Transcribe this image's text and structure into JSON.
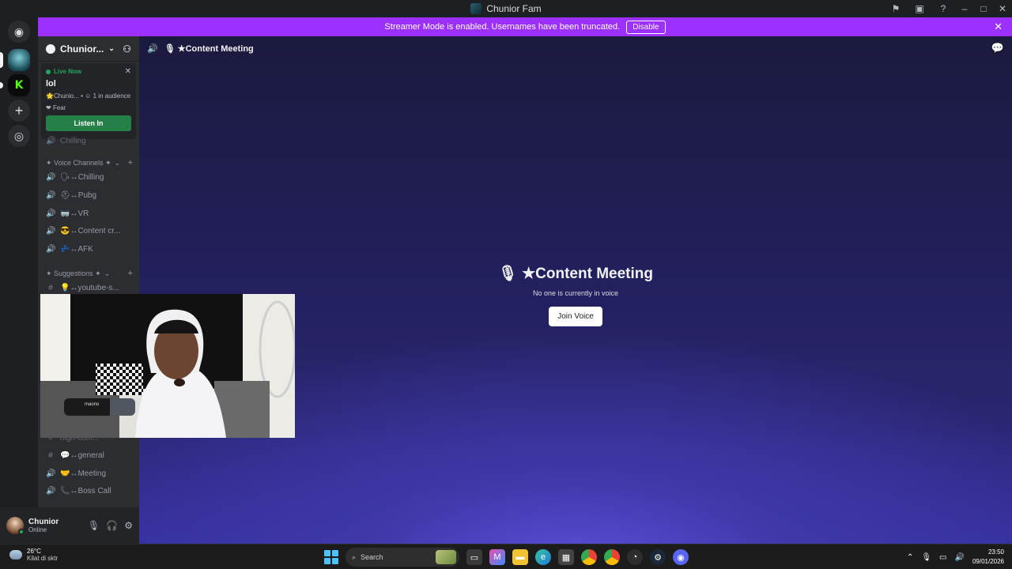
{
  "window": {
    "title": "Chunior Fam"
  },
  "banner": {
    "text": "Streamer Mode is enabled. Usernames have been truncated.",
    "button": "Disable"
  },
  "server": {
    "name": "Chunior..."
  },
  "live": {
    "badge": "Live Now",
    "title": "lol",
    "meta": "🌟Chunio... • ☺ 1 in audience",
    "host": "Fear",
    "button": "Listen In"
  },
  "categories": {
    "voice": "✦ Voice Channels ✦",
    "suggestions": "✦ Suggestions ✦"
  },
  "channels": {
    "partial_top": "Chilling",
    "voice": [
      {
        "label": "🗣↔Chilling"
      },
      {
        "label": "⛑↔Pubg"
      },
      {
        "label": "🥽↔VR"
      },
      {
        "label": "😎↔Content cr..."
      },
      {
        "label": "💤↔AFK"
      }
    ],
    "suggestion": "💡↔youtube-s...",
    "partial_hidden": "high-com...",
    "bottom": [
      {
        "label": "💬↔general",
        "type": "text"
      },
      {
        "label": "🤝↔Meeting",
        "type": "voice"
      },
      {
        "label": "📞↔Boss Call",
        "type": "voice"
      }
    ]
  },
  "user": {
    "name": "Chunior",
    "status": "Online"
  },
  "main": {
    "header": "★Content Meeting",
    "title": "★Content Meeting",
    "subtitle": "No one is currently in voice",
    "join": "Join Voice"
  },
  "webcam": {
    "mic_brand": "maono"
  },
  "taskbar": {
    "temp": "26°C",
    "weather": "Kilat di sktr",
    "search": "Search",
    "time": "23:50",
    "date": "09/01/2026"
  }
}
